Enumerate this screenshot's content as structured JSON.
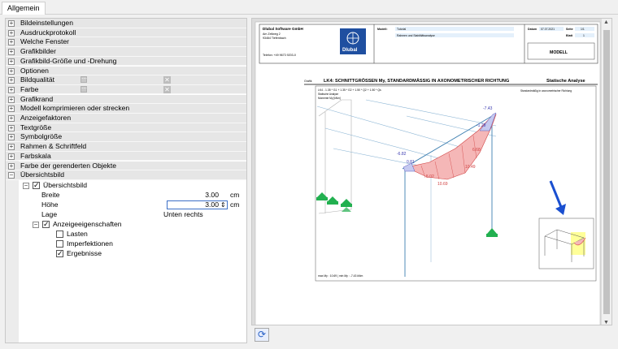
{
  "tab": {
    "label": "Allgemein"
  },
  "tree": {
    "groups": [
      {
        "label": "Bildeinstellungen"
      },
      {
        "label": "Ausdruckprotokoll"
      },
      {
        "label": "Welche Fenster"
      },
      {
        "label": "Grafikbilder"
      },
      {
        "label": "Grafikbild-Größe und -Drehung"
      },
      {
        "label": "Optionen"
      },
      {
        "label": "Bildqualität"
      },
      {
        "label": "Farbe"
      },
      {
        "label": "Grafikrand"
      },
      {
        "label": "Modell komprimieren oder strecken"
      },
      {
        "label": "Anzeigefaktoren"
      },
      {
        "label": "Textgröße"
      },
      {
        "label": "Symbolgröße"
      },
      {
        "label": "Rahmen & Schriftfeld"
      },
      {
        "label": "Farbskala"
      },
      {
        "label": "Farbe der gerenderten Objekte"
      },
      {
        "label": "Übersichtsbild"
      }
    ],
    "overview": {
      "label": "Übersichtsbild",
      "breite_label": "Breite",
      "breite_value": "3.00",
      "breite_unit": "cm",
      "hoehe_label": "Höhe",
      "hoehe_value": "3.00",
      "hoehe_unit": "cm",
      "lage_label": "Lage",
      "lage_value": "Unten rechts",
      "display_label": "Anzeigeeigenschaften",
      "items": [
        {
          "label": "Lasten",
          "checked": false
        },
        {
          "label": "Imperfektionen",
          "checked": false
        },
        {
          "label": "Ergebnisse",
          "checked": true
        }
      ]
    }
  },
  "preview": {
    "company": "Dlubal Software GmbH",
    "addr1": "Am Zellweg 2",
    "addr2": "93464 Tiefenbach",
    "phone": "Telefon: +49 9673 9203-0",
    "logo_text": "Dlubal",
    "modell_key": "Modell:",
    "modell_val": "Tutorial",
    "modell_val2": "Rahmen und Stabilitätsanalyse",
    "datum_key": "Datum",
    "datum_val": "07.07.2021",
    "seite_key": "Seite",
    "seite_val": "1/1",
    "blatt_key": "Blatt",
    "blatt_val": "1",
    "modell_box": "MODELL",
    "grafik": "Grafik",
    "title": "LK4: SCHNITTGRÖSSEN My, STANDARDMÄSSIG IN AXONOMETRISCHER RICHTUNG",
    "category": "Statische Analyse",
    "lc_line": "LK4 - 1.35 * G1 + 1.35 * G2 + 1.50 * Q2 + 1.50 * Qs",
    "lc_line2": "Statische Analyse",
    "lc_line3": "Momente My [kNm]",
    "axon_note": "Standardmäßig in axonometrischer Richtung",
    "values": [
      "-7.43",
      "-1.29",
      "6.68",
      "10.49",
      "-6.82",
      "0.81",
      "5.02",
      "10.69"
    ],
    "footer": "max My : 10.69 | min My : -7.43 kNm"
  }
}
